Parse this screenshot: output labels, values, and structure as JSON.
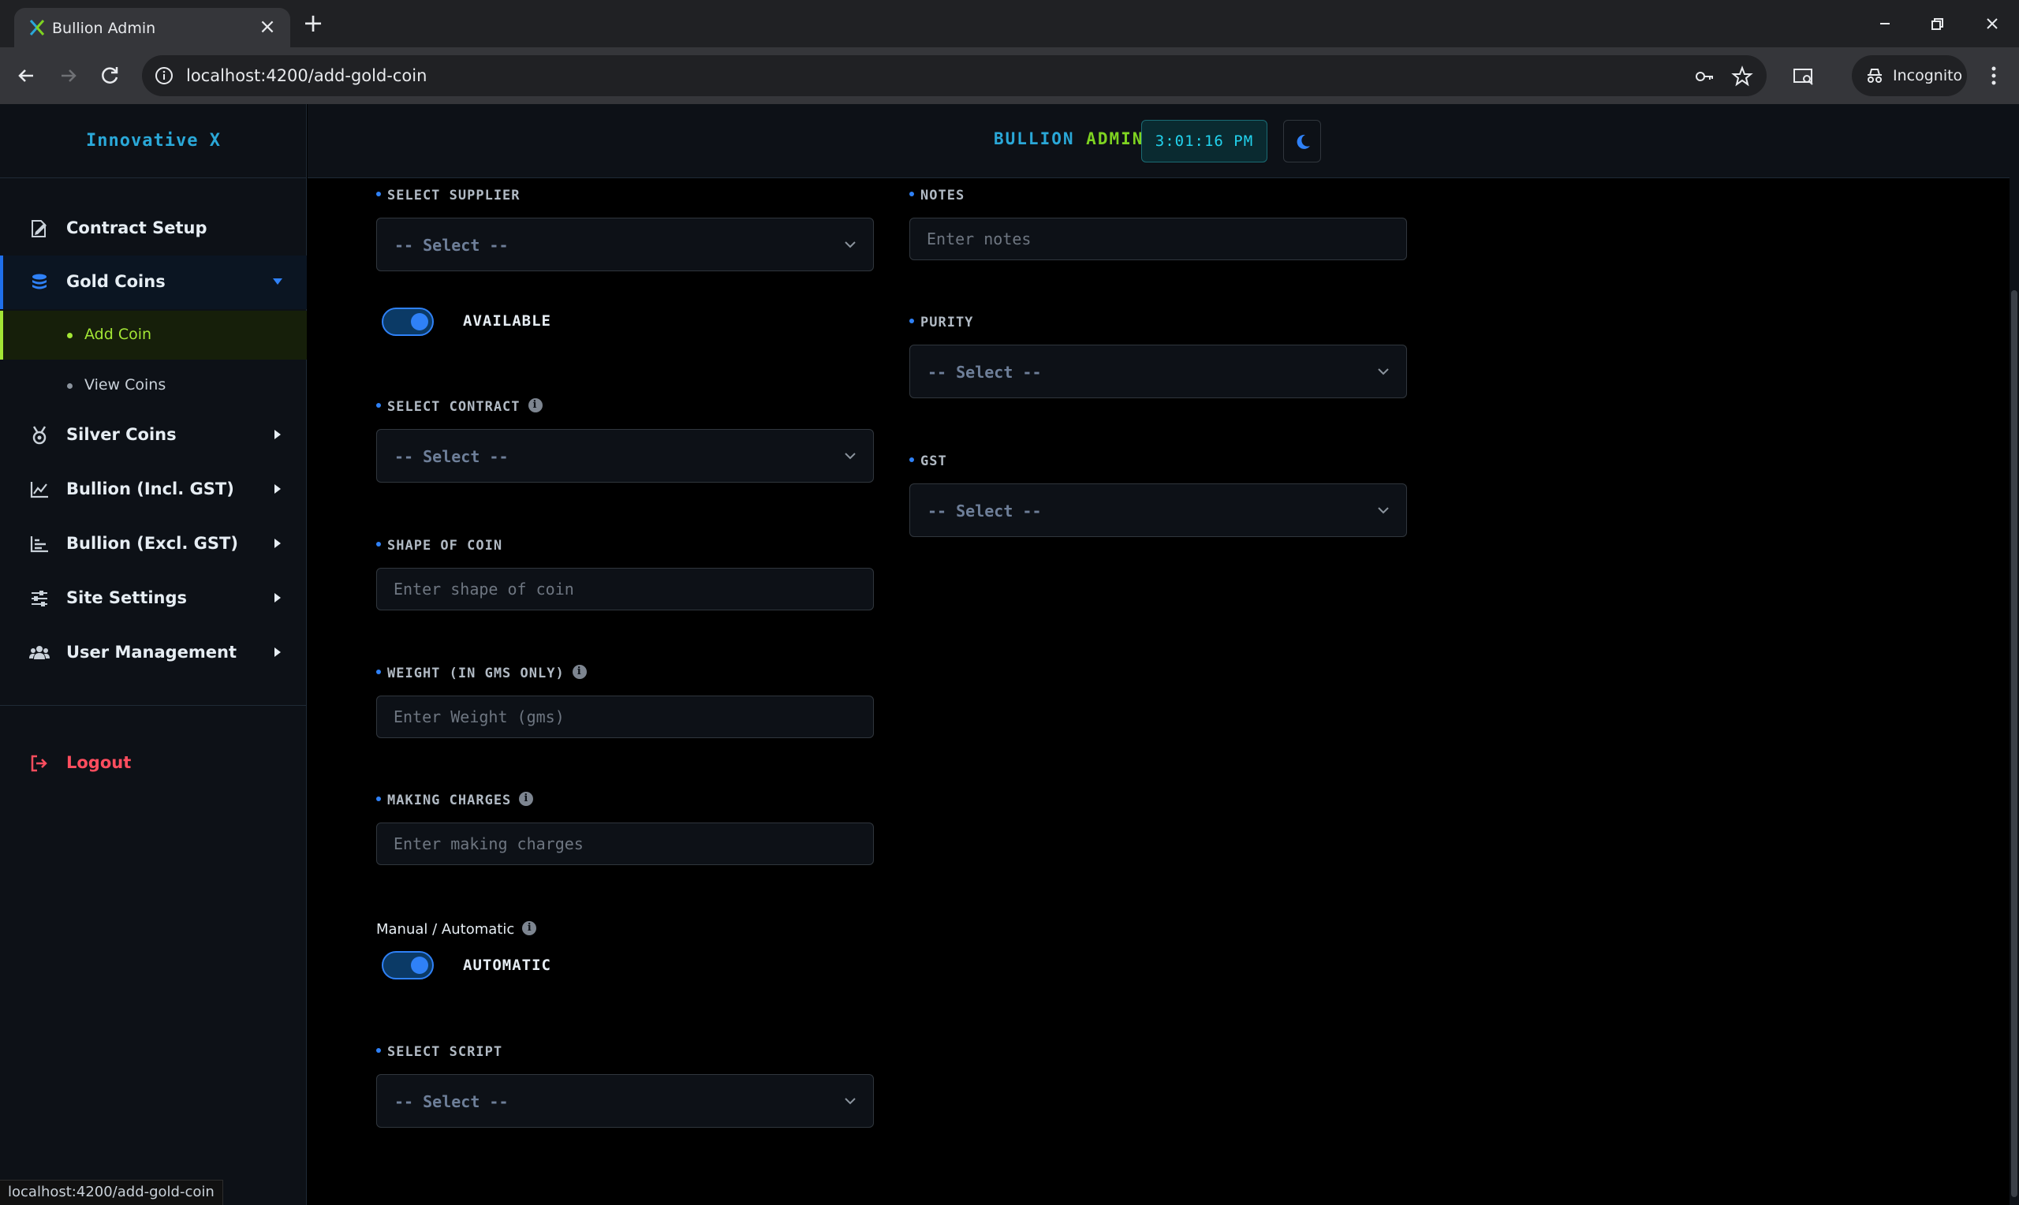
{
  "browser": {
    "tab_title": "Bullion Admin",
    "url": "localhost:4200/add-gold-coin",
    "incognito_label": "Incognito",
    "status_url": "localhost:4200/add-gold-coin"
  },
  "sidebar": {
    "brand": "Innovative X",
    "items": [
      {
        "label": "Contract Setup",
        "icon": "file-signature-icon"
      },
      {
        "label": "Gold Coins",
        "icon": "coins-stack-icon",
        "expanded": true
      },
      {
        "label": "Silver Coins",
        "icon": "medal-icon"
      },
      {
        "label": "Bullion (Incl. GST)",
        "icon": "line-chart-icon"
      },
      {
        "label": "Bullion (Excl. GST)",
        "icon": "bar-chart-icon"
      },
      {
        "label": "Site Settings",
        "icon": "sliders-icon"
      },
      {
        "label": "User Management",
        "icon": "users-icon"
      }
    ],
    "sub_items": [
      {
        "label": "Add Coin",
        "active": true
      },
      {
        "label": "View Coins",
        "active": false
      }
    ],
    "logout": "Logout"
  },
  "header": {
    "title_part1": "BULLION",
    "title_part2": "ADMIN",
    "clock": "3:01:16 PM",
    "theme_icon": "moon-icon"
  },
  "form": {
    "supplier": {
      "label": "SELECT SUPPLIER",
      "value": "-- Select --"
    },
    "available": {
      "label": "AVAILABLE",
      "on": true
    },
    "contract": {
      "label": "SELECT CONTRACT",
      "value": "-- Select --"
    },
    "shape": {
      "label": "SHAPE OF COIN",
      "placeholder": "Enter shape of coin"
    },
    "weight": {
      "label": "WEIGHT (IN GMS ONLY)",
      "placeholder": "Enter Weight (gms)"
    },
    "making": {
      "label": "MAKING CHARGES",
      "placeholder": "Enter making charges"
    },
    "mode": {
      "label": "Manual / Automatic",
      "state_label": "AUTOMATIC",
      "on": true
    },
    "script": {
      "label": "SELECT SCRIPT",
      "value": "-- Select --"
    },
    "notes": {
      "label": "NOTES",
      "placeholder": "Enter notes"
    },
    "purity": {
      "label": "PURITY",
      "value": "-- Select --"
    },
    "gst": {
      "label": "GST",
      "value": "-- Select --"
    }
  },
  "colors": {
    "accent_blue": "#2f81f7",
    "accent_green": "#a3e635",
    "brand_cyan": "#2aa8d8",
    "logout_red": "#ff4d5e"
  }
}
